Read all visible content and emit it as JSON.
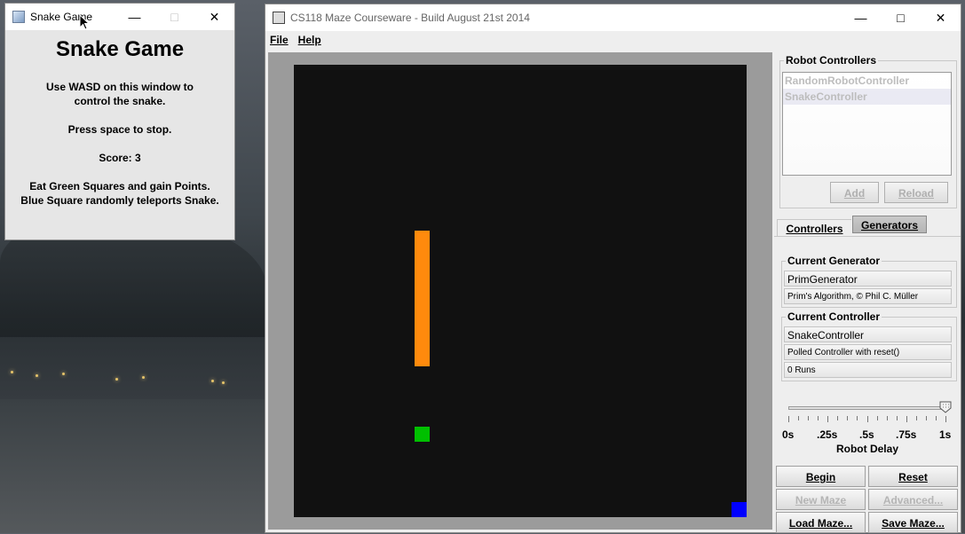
{
  "snake_window": {
    "title": "Snake Game",
    "heading": "Snake Game",
    "instructions_line1": "Use WASD on this window to",
    "instructions_line2": "control the snake.",
    "stop_text": "Press space to stop.",
    "score_text": "Score: 3",
    "info_line1": "Eat Green Squares and gain Points.",
    "info_line2": "Blue Square randomly teleports Snake."
  },
  "maze_window": {
    "title": "CS118 Maze Courseware - Build August 21st 2014",
    "menu": [
      {
        "label": "File"
      },
      {
        "label": "Help"
      }
    ],
    "colors": {
      "board": "#111111",
      "snake": "#ff8a0d",
      "food": "#00c000",
      "teleport": "#0000ff",
      "frame": "#9b9b9b"
    }
  },
  "side_panel": {
    "robot_controllers_label": "Robot Controllers",
    "controllers": [
      {
        "name": "RandomRobotController"
      },
      {
        "name": "SnakeController"
      }
    ],
    "add_label": "Add",
    "reload_label": "Reload",
    "tabs": [
      {
        "label": "Controllers"
      },
      {
        "label": "Generators"
      }
    ],
    "current_generator_label": "Current Generator",
    "generator_name": "PrimGenerator",
    "generator_desc": "Prim's Algorithm, © Phil C. Müller",
    "current_controller_label": "Current Controller",
    "controller_name": "SnakeController",
    "controller_desc": "Polled Controller with reset()",
    "runs": "0 Runs",
    "delay_labels": [
      "0s",
      ".25s",
      ".5s",
      ".75s",
      "1s"
    ],
    "delay_value": 1,
    "robot_delay_label": "Robot Delay",
    "buttons": {
      "begin": "Begin",
      "reset": "Reset",
      "new_maze": "New Maze",
      "advanced": "Advanced...",
      "load_maze": "Load Maze...",
      "save_maze": "Save Maze..."
    }
  }
}
